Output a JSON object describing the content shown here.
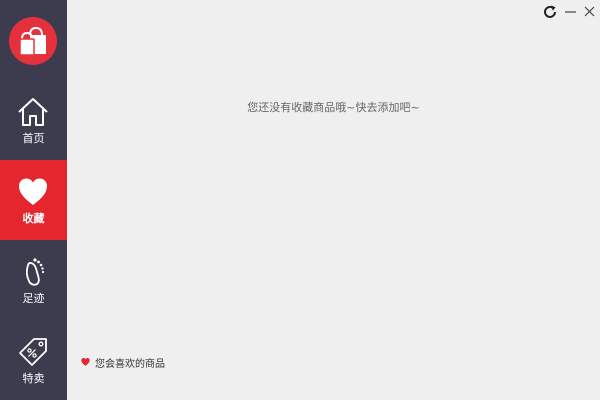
{
  "sidebar": {
    "logo_icon": "shopping-bags-icon",
    "items": [
      {
        "id": "home",
        "label": "首页",
        "icon": "house-icon",
        "active": false
      },
      {
        "id": "favorites",
        "label": "收藏",
        "icon": "heart-icon",
        "active": true
      },
      {
        "id": "footprints",
        "label": "足迹",
        "icon": "footprint-icon",
        "active": false
      },
      {
        "id": "sale",
        "label": "特卖",
        "icon": "discount-tag-icon",
        "active": false
      }
    ]
  },
  "window_controls": {
    "refresh_icon": "refresh-icon",
    "minimize_icon": "minimize-icon",
    "close_icon": "close-icon"
  },
  "main": {
    "empty_message": "您还没有收藏商品哦~快去添加吧~",
    "recommend_label": "您会喜欢的商品"
  },
  "colors": {
    "sidebar_bg": "#3c3c4e",
    "accent_red": "#e4262e",
    "content_bg": "#efefef"
  }
}
